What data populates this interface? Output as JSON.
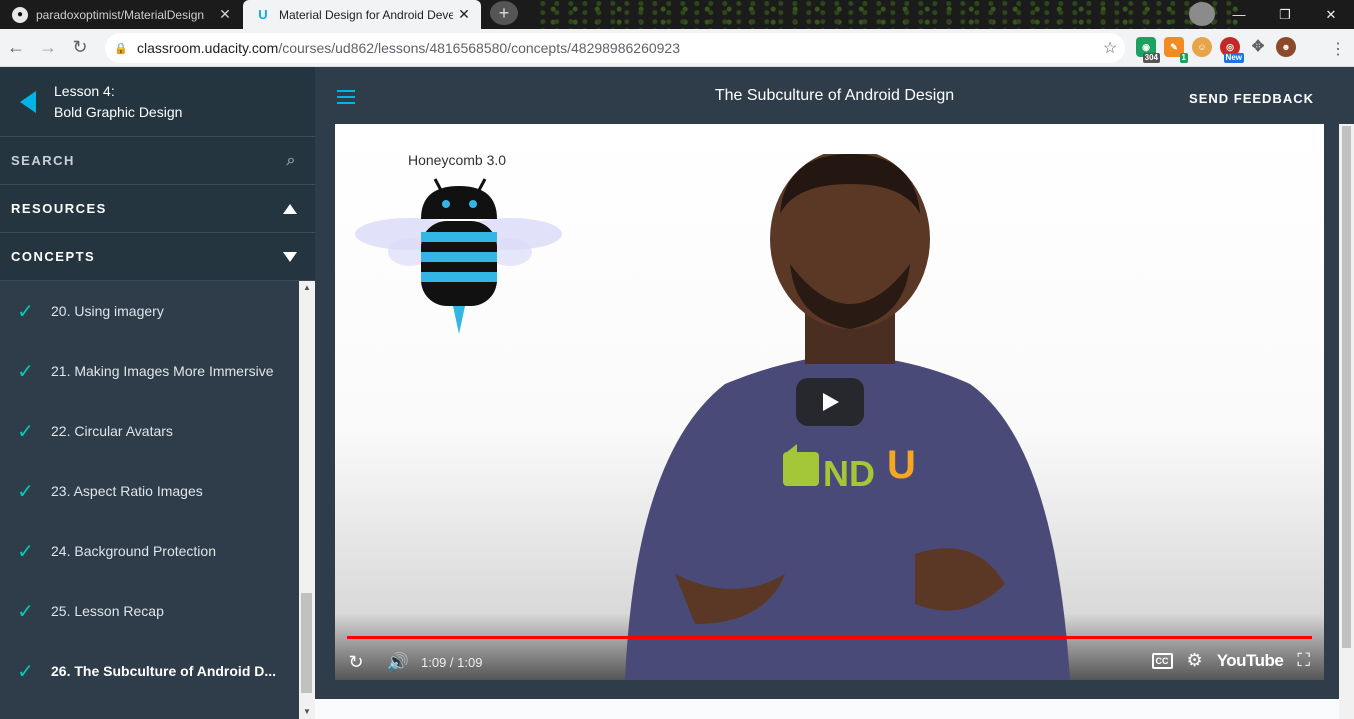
{
  "browser": {
    "tabs": [
      {
        "title": "paradoxoptimist/MaterialDesign",
        "icon": "github-icon",
        "active": false
      },
      {
        "title": "Material Design for Android Deve",
        "icon": "udacity-icon",
        "active": true
      }
    ],
    "new_tab_label": "+",
    "url_host": "classroom.udacity.com",
    "url_path": "/courses/ud862/lessons/4816568580/concepts/48298986260923",
    "extensions": [
      {
        "name": "ext-304",
        "badge": "304",
        "color": "#1aa260"
      },
      {
        "name": "ext-1",
        "badge": "1",
        "color": "#f28b22"
      },
      {
        "name": "ext-monkey",
        "badge": "",
        "color": "#e8a44a"
      },
      {
        "name": "ext-new",
        "badge": "New",
        "color": "#1a73e8"
      }
    ]
  },
  "sidebar": {
    "lesson_number": "Lesson 4:",
    "lesson_title": "Bold Graphic Design",
    "search_label": "SEARCH",
    "resources_label": "RESOURCES",
    "concepts_label": "CONCEPTS",
    "concepts": [
      {
        "label": "20. Using imagery",
        "done": true,
        "current": false
      },
      {
        "label": "21. Making Images More Immersive",
        "done": true,
        "current": false
      },
      {
        "label": "22. Circular Avatars",
        "done": true,
        "current": false
      },
      {
        "label": "23. Aspect Ratio Images",
        "done": true,
        "current": false
      },
      {
        "label": "24. Background Protection",
        "done": true,
        "current": false
      },
      {
        "label": "25. Lesson Recap",
        "done": true,
        "current": false
      },
      {
        "label": "26. The Subculture of Android D...",
        "done": true,
        "current": true
      }
    ]
  },
  "main": {
    "title": "The Subculture of Android Design",
    "feedback_label": "SEND FEEDBACK"
  },
  "video": {
    "overlay_text": "Honeycomb 3.0",
    "shirt_text_1": "ND",
    "shirt_text_2": "U",
    "time": "1:09 / 1:09",
    "progress": 1.0,
    "youtube_label": "YouTube",
    "cc_label": "CC"
  },
  "colors": {
    "accent": "#02b3e4",
    "check": "#02ccba",
    "sidebar_bg": "#2e3d49",
    "progress": "#ff0000"
  }
}
